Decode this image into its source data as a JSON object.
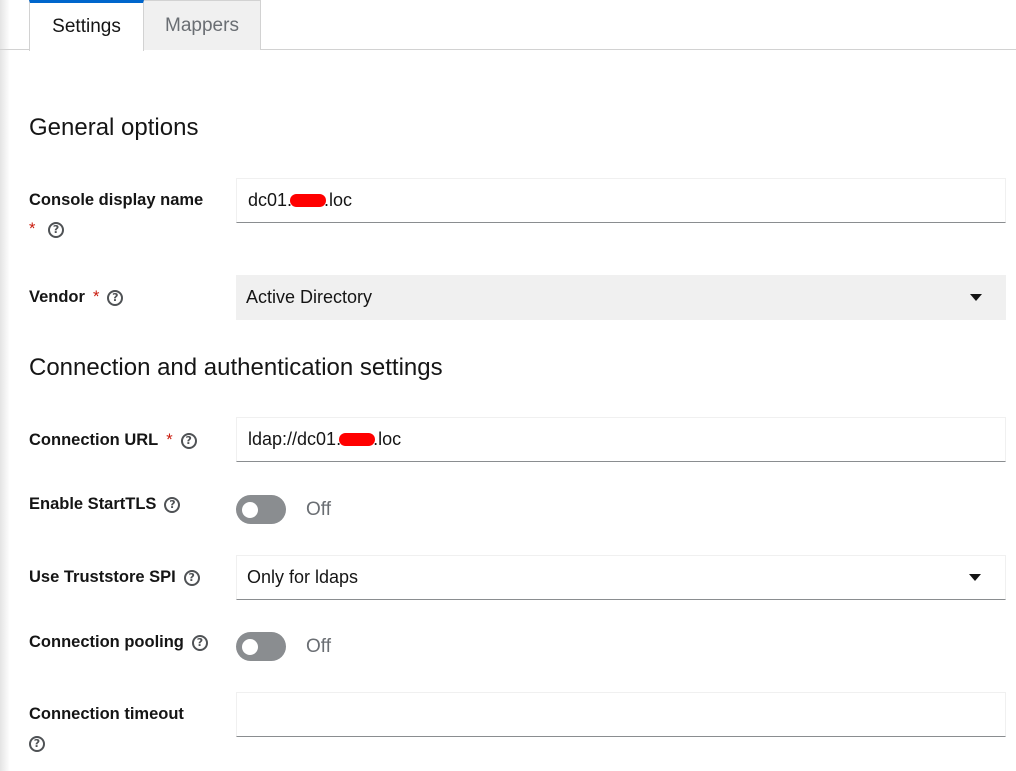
{
  "tabs": [
    {
      "label": "Settings",
      "active": true
    },
    {
      "label": "Mappers",
      "active": false
    }
  ],
  "sections": {
    "general_title": "General options",
    "connection_title": "Connection and authentication settings"
  },
  "fields": {
    "console_display_name": {
      "label": "Console display name",
      "required_mark": "*",
      "value_prefix": "dc01.",
      "value_suffix": ".loc"
    },
    "vendor": {
      "label": "Vendor",
      "required_mark": "*",
      "value": "Active Directory"
    },
    "connection_url": {
      "label": "Connection URL",
      "required_mark": "*",
      "value_prefix": "ldap://dc01.",
      "value_suffix": ".loc"
    },
    "enable_starttls": {
      "label": "Enable StartTLS",
      "state": "Off"
    },
    "use_truststore_spi": {
      "label": "Use Truststore SPI",
      "value": "Only for ldaps"
    },
    "connection_pooling": {
      "label": "Connection pooling",
      "state": "Off"
    },
    "connection_timeout": {
      "label": "Connection timeout",
      "value": ""
    }
  },
  "icons": {
    "help": "question-circle-icon",
    "caret": "caret-down-icon"
  },
  "help_glyph": "?",
  "colors": {
    "accent": "#0066cc",
    "required": "#c9190b",
    "switch_off": "#8a8d90",
    "redaction": "#ff0000"
  }
}
